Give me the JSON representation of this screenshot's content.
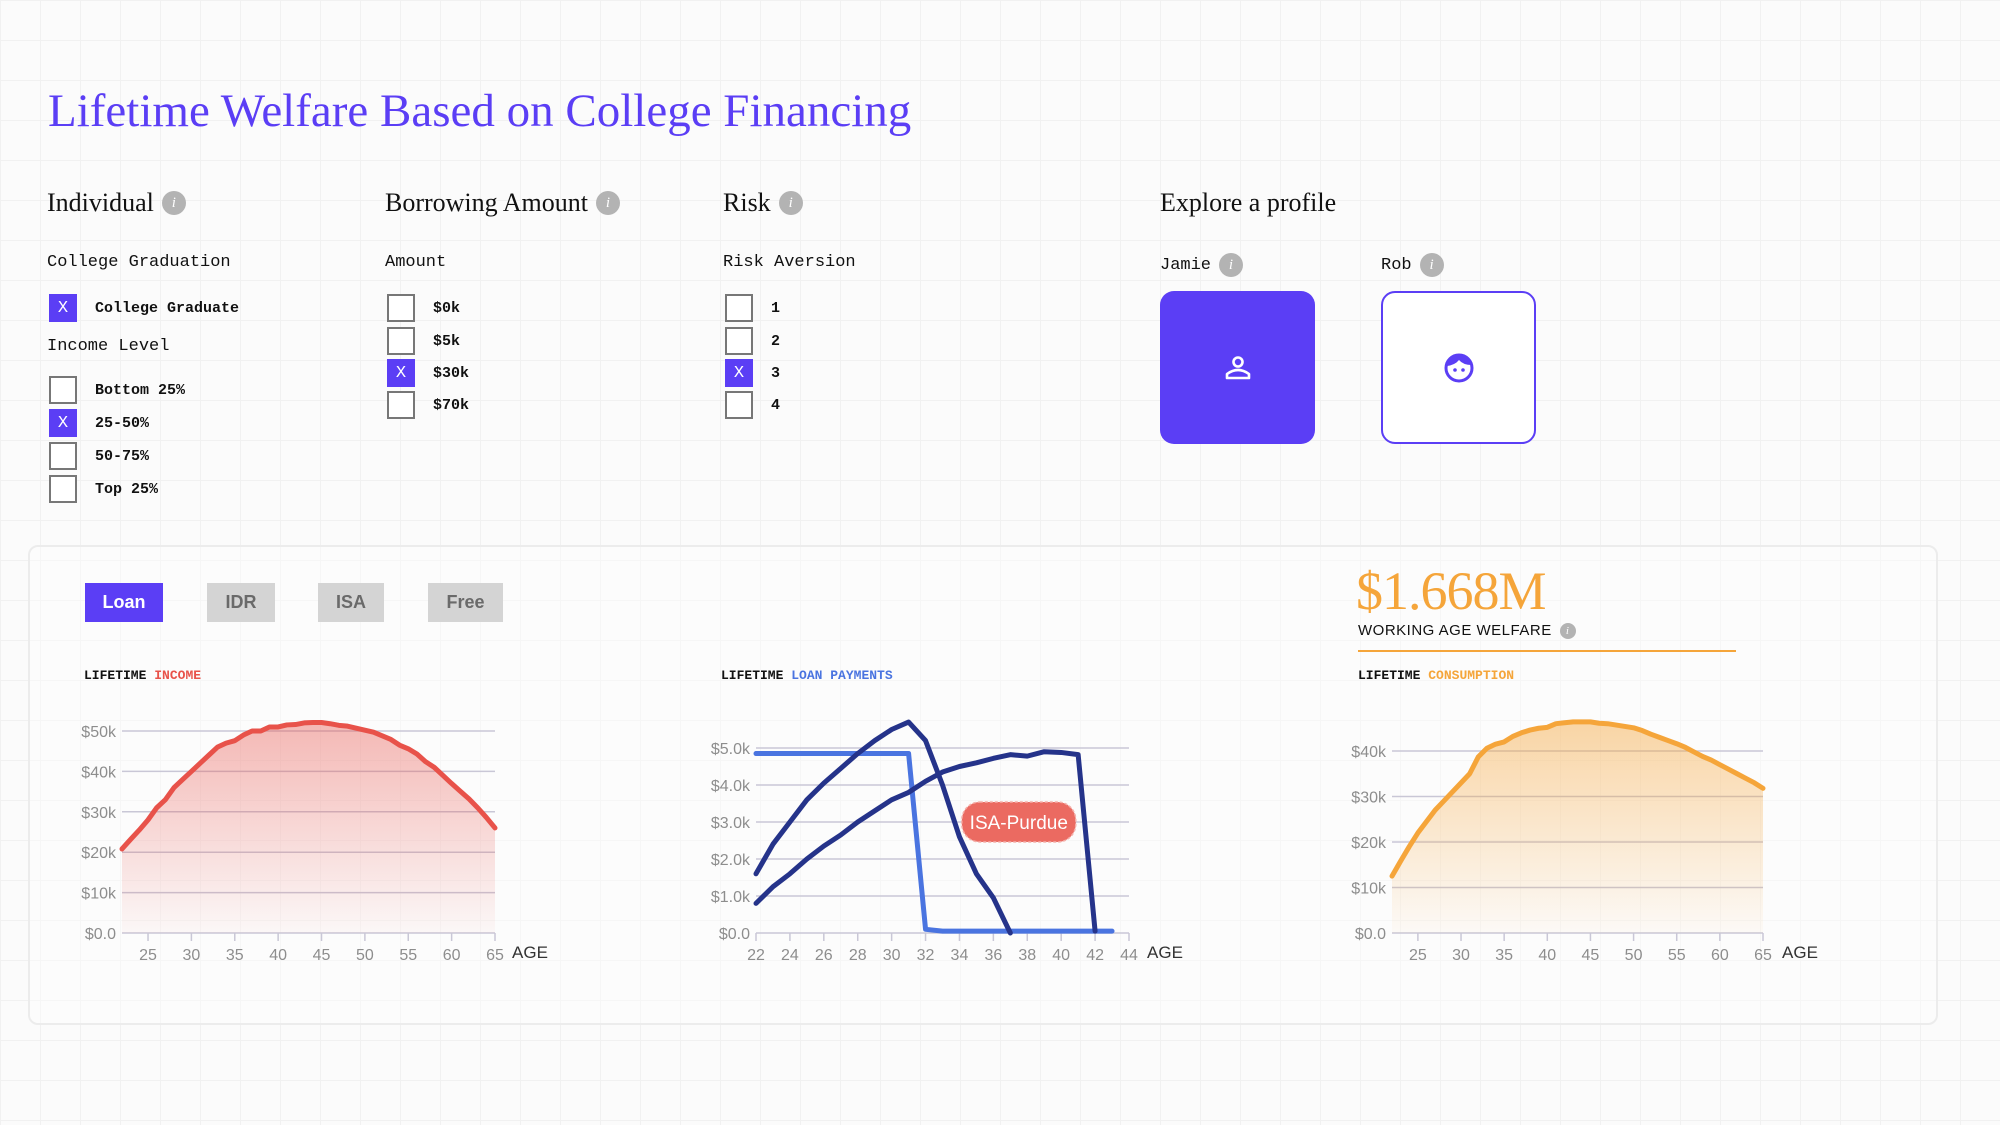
{
  "title": "Lifetime Welfare Based on College Financing",
  "info_glyph": "i",
  "individual": {
    "heading": "Individual",
    "graduation_label": "College Graduation",
    "graduation_options": [
      {
        "label": "College Graduate",
        "checked": true
      }
    ],
    "income_label": "Income Level",
    "income_options": [
      {
        "label": "Bottom 25%",
        "checked": false
      },
      {
        "label": "25-50%",
        "checked": true
      },
      {
        "label": "50-75%",
        "checked": false
      },
      {
        "label": "Top 25%",
        "checked": false
      }
    ]
  },
  "borrowing": {
    "heading": "Borrowing Amount",
    "amount_label": "Amount",
    "options": [
      {
        "label": "$0k",
        "checked": false
      },
      {
        "label": "$5k",
        "checked": false
      },
      {
        "label": "$30k",
        "checked": true
      },
      {
        "label": "$70k",
        "checked": false
      }
    ]
  },
  "risk": {
    "heading": "Risk",
    "aversion_label": "Risk Aversion",
    "options": [
      {
        "label": "1",
        "checked": false
      },
      {
        "label": "2",
        "checked": false
      },
      {
        "label": "3",
        "checked": true
      },
      {
        "label": "4",
        "checked": false
      }
    ]
  },
  "check_mark": "X",
  "profiles": {
    "heading": "Explore a profile",
    "items": [
      {
        "name": "Jamie",
        "icon": "person-outline-icon",
        "selected": true
      },
      {
        "name": "Rob",
        "icon": "face-icon",
        "selected": false
      }
    ]
  },
  "tabs": [
    {
      "label": "Loan",
      "active": true
    },
    {
      "label": "IDR",
      "active": false
    },
    {
      "label": "ISA",
      "active": false
    },
    {
      "label": "Free",
      "active": false
    }
  ],
  "welfare": {
    "value": "$1.668M",
    "label": "WORKING AGE WELFARE"
  },
  "colors": {
    "accent": "#5b3ef5",
    "income": "#e8524a",
    "loan_light": "#4a74e0",
    "loan_dark": "#25338a",
    "consumption": "#f5a53a",
    "annotation": "#eb6a61"
  },
  "chart_data": [
    {
      "type": "area",
      "title_prefix": "LIFETIME",
      "title_highlight": "INCOME",
      "xlabel": "AGE",
      "xlim": [
        22,
        65
      ],
      "ylim": [
        0,
        52
      ],
      "x_ticks": [
        "25",
        "30",
        "35",
        "40",
        "45",
        "50",
        "55",
        "60",
        "65"
      ],
      "y_ticks": [
        "$0.0",
        "$10k",
        "$20k",
        "$30k",
        "$40k",
        "$50k"
      ],
      "y_tick_values": [
        0,
        10,
        20,
        30,
        40,
        50
      ],
      "x": [
        22,
        23,
        24,
        25,
        26,
        27,
        28,
        29,
        30,
        31,
        32,
        33,
        34,
        35,
        36,
        37,
        38,
        39,
        40,
        41,
        42,
        43,
        44,
        45,
        46,
        47,
        48,
        49,
        50,
        51,
        52,
        53,
        54,
        55,
        56,
        57,
        58,
        59,
        60,
        61,
        62,
        63,
        64,
        65
      ],
      "values": [
        20.8,
        23.2,
        25.5,
        28,
        31,
        33,
        36,
        38,
        40,
        42,
        44,
        46,
        47,
        47.6,
        49,
        50,
        50,
        51,
        51,
        51.5,
        51.6,
        52,
        52.1,
        52.1,
        51.8,
        51.4,
        51.2,
        50.7,
        50.2,
        49.7,
        48.8,
        47.9,
        46.5,
        45.6,
        44.3,
        42.4,
        41,
        39,
        37,
        35.1,
        33.2,
        31,
        28.6,
        26
      ],
      "grid": true
    },
    {
      "type": "line",
      "title_prefix": "LIFETIME",
      "title_highlight": "LOAN PAYMENTS",
      "xlabel": "AGE",
      "xlim": [
        22,
        44
      ],
      "ylim": [
        0,
        5.8
      ],
      "x_ticks": [
        "22",
        "24",
        "26",
        "28",
        "30",
        "32",
        "34",
        "36",
        "38",
        "40",
        "42",
        "44"
      ],
      "y_ticks": [
        "$0.0",
        "$1.0k",
        "$2.0k",
        "$3.0k",
        "$4.0k",
        "$5.0k"
      ],
      "y_tick_values": [
        0,
        1,
        2,
        3,
        4,
        5
      ],
      "series": [
        {
          "x": [
            22,
            23,
            24,
            25,
            26,
            27,
            28,
            29,
            30,
            31,
            32,
            33,
            34,
            35,
            36,
            37,
            38,
            39,
            40,
            41,
            42,
            43
          ],
          "values": [
            4.85,
            4.85,
            4.85,
            4.85,
            4.85,
            4.85,
            4.85,
            4.85,
            4.85,
            4.85,
            0.1,
            0.05,
            0.05,
            0.05,
            0.05,
            0.05,
            0.05,
            0.05,
            0.05,
            0.05,
            0.05,
            0.05
          ],
          "color": "#4a74e0"
        },
        {
          "x": [
            22,
            23,
            24,
            25,
            26,
            27,
            28,
            29,
            30,
            31,
            32,
            33,
            34,
            35,
            36,
            37
          ],
          "values": [
            1.6,
            2.4,
            3.0,
            3.6,
            4.05,
            4.45,
            4.85,
            5.2,
            5.5,
            5.7,
            5.2,
            4.0,
            2.6,
            1.6,
            0.95,
            0.0
          ],
          "color": "#25338a"
        },
        {
          "x": [
            22,
            23,
            24,
            25,
            26,
            27,
            28,
            29,
            30,
            31,
            32,
            33,
            34,
            35,
            36,
            37,
            38,
            39,
            40,
            41,
            42
          ],
          "values": [
            0.8,
            1.25,
            1.6,
            2.0,
            2.35,
            2.65,
            3.0,
            3.3,
            3.6,
            3.8,
            4.1,
            4.35,
            4.5,
            4.6,
            4.72,
            4.82,
            4.78,
            4.9,
            4.88,
            4.82,
            0.05
          ],
          "color": "#25338a"
        }
      ],
      "annotation": {
        "text": "ISA-Purdue",
        "x": 37.5,
        "y": 3.0
      },
      "grid": true
    },
    {
      "type": "area",
      "title_prefix": "LIFETIME",
      "title_highlight": "CONSUMPTION",
      "xlabel": "AGE",
      "xlim": [
        22,
        65
      ],
      "ylim": [
        0,
        47
      ],
      "x_ticks": [
        "25",
        "30",
        "35",
        "40",
        "45",
        "50",
        "55",
        "60",
        "65"
      ],
      "y_ticks": [
        "$0.0",
        "$10k",
        "$20k",
        "$30k",
        "$40k"
      ],
      "y_tick_values": [
        0,
        10,
        20,
        30,
        40
      ],
      "x": [
        22,
        23,
        24,
        25,
        26,
        27,
        28,
        29,
        30,
        31,
        32,
        33,
        34,
        35,
        36,
        37,
        38,
        39,
        40,
        41,
        42,
        43,
        44,
        45,
        46,
        47,
        48,
        49,
        50,
        51,
        52,
        53,
        54,
        55,
        56,
        57,
        58,
        59,
        60,
        61,
        62,
        63,
        64,
        65
      ],
      "values": [
        12.5,
        15.8,
        19,
        22,
        24.5,
        27,
        29,
        31,
        33,
        35,
        38.7,
        40.6,
        41.5,
        42,
        43.2,
        44,
        44.6,
        45,
        45.2,
        46,
        46.2,
        46.4,
        46.4,
        46.4,
        46.1,
        46,
        45.7,
        45.4,
        45.1,
        44.5,
        43.7,
        43,
        42.3,
        41.6,
        40.8,
        39.8,
        38.8,
        38,
        37,
        36,
        35,
        34,
        33,
        31.8
      ],
      "grid": true
    }
  ]
}
